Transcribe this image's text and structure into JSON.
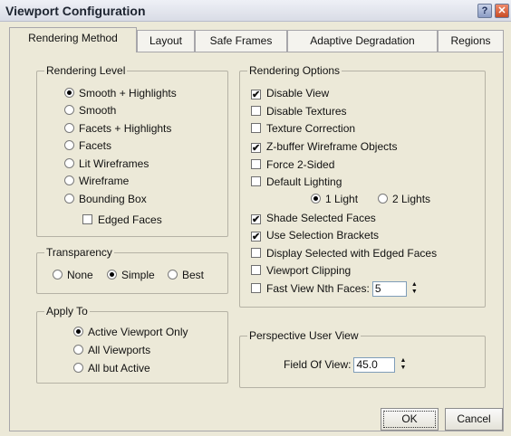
{
  "window": {
    "title": "Viewport Configuration"
  },
  "title_buttons": {
    "help": "?",
    "close": "✕"
  },
  "tabs": [
    {
      "label": "Rendering Method",
      "active": true
    },
    {
      "label": "Layout"
    },
    {
      "label": "Safe Frames"
    },
    {
      "label": "Adaptive Degradation"
    },
    {
      "label": "Regions"
    }
  ],
  "rendering_level": {
    "title": "Rendering Level",
    "options": [
      "Smooth + Highlights",
      "Smooth",
      "Facets + Highlights",
      "Facets",
      "Lit Wireframes",
      "Wireframe",
      "Bounding Box"
    ],
    "selected": 0,
    "edged_faces": {
      "label": "Edged Faces",
      "checked": false
    }
  },
  "transparency": {
    "title": "Transparency",
    "options": [
      "None",
      "Simple",
      "Best"
    ],
    "selected": 1
  },
  "apply_to": {
    "title": "Apply To",
    "options": [
      "Active Viewport Only",
      "All Viewports",
      "All but Active"
    ],
    "selected": 0
  },
  "rendering_options": {
    "title": "Rendering Options",
    "disable_view": {
      "label": "Disable View",
      "checked": true
    },
    "disable_textures": {
      "label": "Disable Textures",
      "checked": false
    },
    "texture_correction": {
      "label": "Texture Correction",
      "checked": false
    },
    "zbuffer": {
      "label": "Z-buffer Wireframe Objects",
      "checked": true
    },
    "force_2_sided": {
      "label": "Force 2-Sided",
      "checked": false
    },
    "default_lighting": {
      "label": "Default Lighting",
      "checked": false
    },
    "light_1": "1 Light",
    "light_2": "2 Lights",
    "light_selected": 0,
    "shade_selected": {
      "label": "Shade Selected Faces",
      "checked": true
    },
    "selection_brackets": {
      "label": "Use Selection Brackets",
      "checked": true
    },
    "display_edged": {
      "label": "Display Selected with Edged Faces",
      "checked": false
    },
    "viewport_clipping": {
      "label": "Viewport Clipping",
      "checked": false
    },
    "fast_view": {
      "label": "Fast View Nth Faces:",
      "checked": false,
      "value": "5"
    }
  },
  "perspective": {
    "title": "Perspective User View",
    "fov_label": "Field Of View:",
    "fov_value": "45.0"
  },
  "buttons": {
    "ok": "OK",
    "cancel": "Cancel"
  },
  "glyphs": {
    "check": "✔",
    "spin_up": "▲",
    "spin_down": "▼"
  }
}
